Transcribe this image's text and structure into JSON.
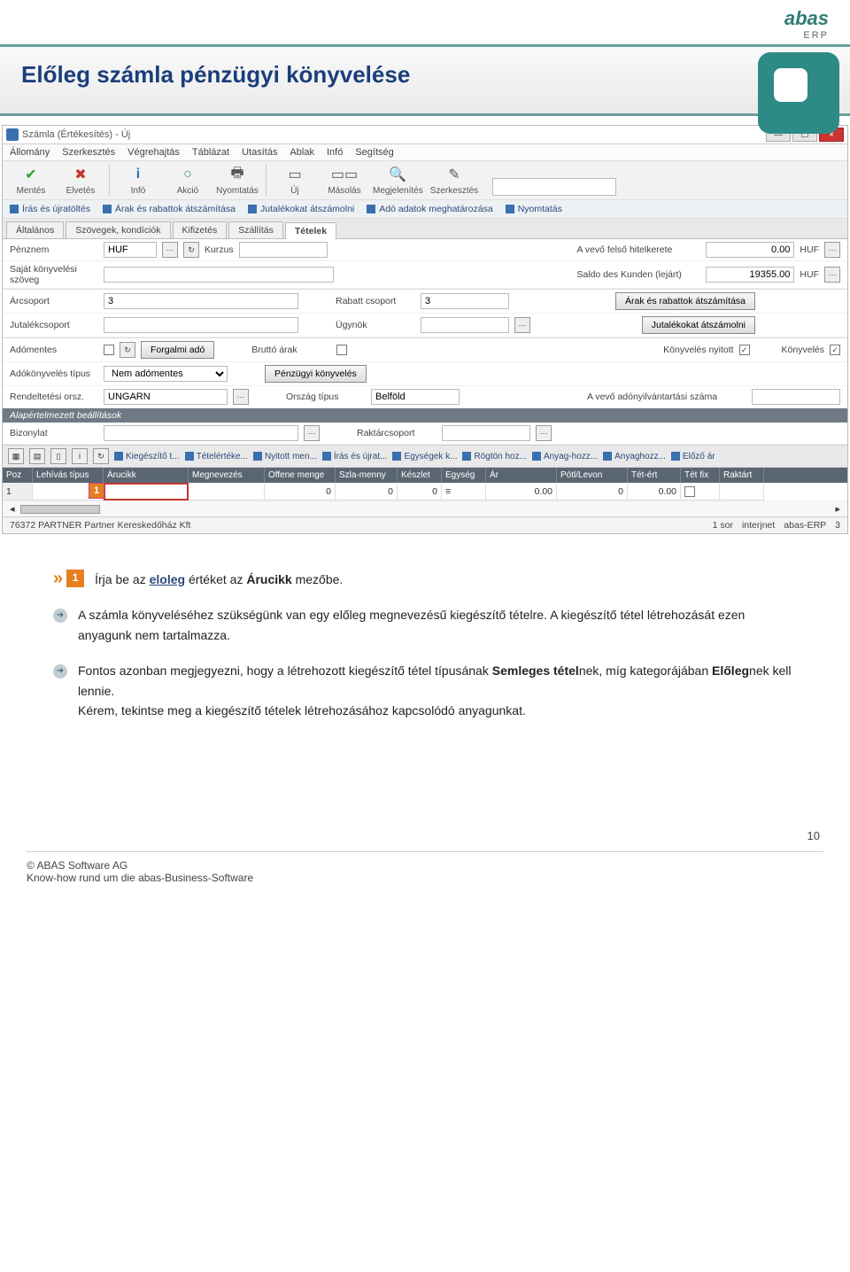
{
  "slide": {
    "title": "Előleg számla pénzügyi könyvelése"
  },
  "logo": {
    "top": "abas",
    "bottom": "ERP"
  },
  "window": {
    "title": "Számla (Értékesítés) - Új",
    "winbtns": {
      "min": "—",
      "max": "☐",
      "close": "×"
    }
  },
  "menu": {
    "items": [
      "Állomány",
      "Szerkesztés",
      "Végrehajtás",
      "Táblázat",
      "Utasítás",
      "Ablak",
      "Infó",
      "Segítség"
    ]
  },
  "toolbar": {
    "items": [
      {
        "label": "Mentés",
        "icon": "✔",
        "color": "#2e9e2e"
      },
      {
        "label": "Elvetés",
        "icon": "✖",
        "color": "#c0392b"
      },
      {
        "label": "Infó",
        "icon": "i",
        "color": "#2a6fb3"
      },
      {
        "label": "Akció",
        "icon": "○",
        "color": "#2e8a84"
      },
      {
        "label": "Nyomtatás",
        "icon": "🖶",
        "color": "#777"
      },
      {
        "label": "Új",
        "icon": "▭",
        "color": "#5b8bd0"
      },
      {
        "label": "Másolás",
        "icon": "▭▭",
        "color": "#5b8bd0"
      },
      {
        "label": "Megjelenítés",
        "icon": "🔍",
        "color": "#777"
      },
      {
        "label": "Szerkesztés",
        "icon": "✎",
        "color": "#b08a2e"
      }
    ]
  },
  "chipbar": {
    "items": [
      "Írás és újratöltés",
      "Árak és rabattok átszámítása",
      "Jutalékokat átszámolni",
      "Adó adatok meghatározása",
      "Nyomtatás"
    ]
  },
  "tabs": {
    "items": [
      "Általános",
      "Szövegek, kondíciók",
      "Kifizetés",
      "Szállítás",
      "Tételek"
    ],
    "active_index": 4
  },
  "form": {
    "penznem_label": "Pénznem",
    "penznem_value": "HUF",
    "kurzus_label": "Kurzus",
    "hitelkeret_label": "A vevő felső hitelkerete",
    "hitelkeret_value": "0.00",
    "hitelkeret_unit": "HUF",
    "sajat_label": "Saját könyvelési szöveg",
    "saldo_label": "Saldo des Kunden (lejárt)",
    "saldo_value": "19355.00",
    "saldo_unit": "HUF",
    "arcsoport_label": "Árcsoport",
    "arcsoport_value": "3",
    "rabatt_label": "Rabatt csoport",
    "rabatt_value": "3",
    "btn_arak": "Árak és rabattok átszámítása",
    "jutalek_label": "Jutalékcsoport",
    "ugynok_label": "Ügynök",
    "btn_jutalek": "Jutalékokat átszámolni",
    "adomentes_label": "Adómentes",
    "forgalmi_btn": "Forgalmi adó",
    "brutto_label": "Bruttó árak",
    "kony_nyitott_label": "Könyvelés nyitott",
    "konyveles_label": "Könyvelés",
    "adokony_label": "Adókönyvelés típus",
    "adokony_value": "Nem adómentes",
    "penzugyi_btn": "Pénzügyi könyvelés",
    "rendelt_label": "Rendeltetési orsz.",
    "rendelt_value": "UNGARN",
    "orszag_label": "Ország típus",
    "orszag_value": "Belföld",
    "adonyil_label": "A vevő adónyilvántartási száma",
    "section_head": "Alapértelmezett beállítások",
    "bizonylat_label": "Bizonylat",
    "raktar_label": "Raktárcsoport"
  },
  "toolstrip": {
    "items": [
      "Kiegészítő t...",
      "Tételértéke...",
      "Nyitott men...",
      "Írás és újrat...",
      "Egységek k...",
      "Rögtön hoz...",
      "Anyag-hozz...",
      "Anyaghozz...",
      "Előző ár"
    ]
  },
  "grid": {
    "headers": [
      "Poz",
      "Lehívás típus",
      "Árucikk",
      "Megnevezés",
      "Offene menge",
      "Szla-menny",
      "Készlet",
      "Egység",
      "Ár",
      "Pótl/Levon",
      "Tét-ért",
      "Tét fix",
      "Raktárt"
    ],
    "row": {
      "poz": "1",
      "offene": "0",
      "szla": "0",
      "keszlet": "0",
      "ar": "0.00",
      "potl": "0",
      "tetert": "0.00"
    },
    "badge": "1"
  },
  "status": {
    "left": "76372 PARTNER  Partner Kereskedőház Kft",
    "sor": "1 sor",
    "net": "interjnet",
    "app": "abas-ERP",
    "num": "3"
  },
  "desc": {
    "badge1": "1",
    "line1a": "Írja be az ",
    "line1b": "eloleg",
    "line1c": " értéket az ",
    "line1d": "Árucikk",
    "line1e": " mezőbe.",
    "line2": "A számla könyveléséhez szükségünk van egy előleg megnevezésű kiegészítő tételre. A kiegészítő tétel létrehozását ezen anyagunk nem tartalmazza.",
    "line3a": "Fontos azonban megjegyezni, hogy a létrehozott kiegészítő tétel típusának ",
    "line3b": "Semleges tétel",
    "line3c": "nek, míg kategorájában ",
    "line3d": "Előleg",
    "line3e": "nek kell lennie.",
    "line3f": "Kérem, tekintse meg a kiegészítő tételek létrehozásához kapcsolódó anyagunkat."
  },
  "footer": {
    "page": "10",
    "l1": "© ABAS Software AG",
    "l2": "Know-how rund um die abas-Business-Software"
  }
}
